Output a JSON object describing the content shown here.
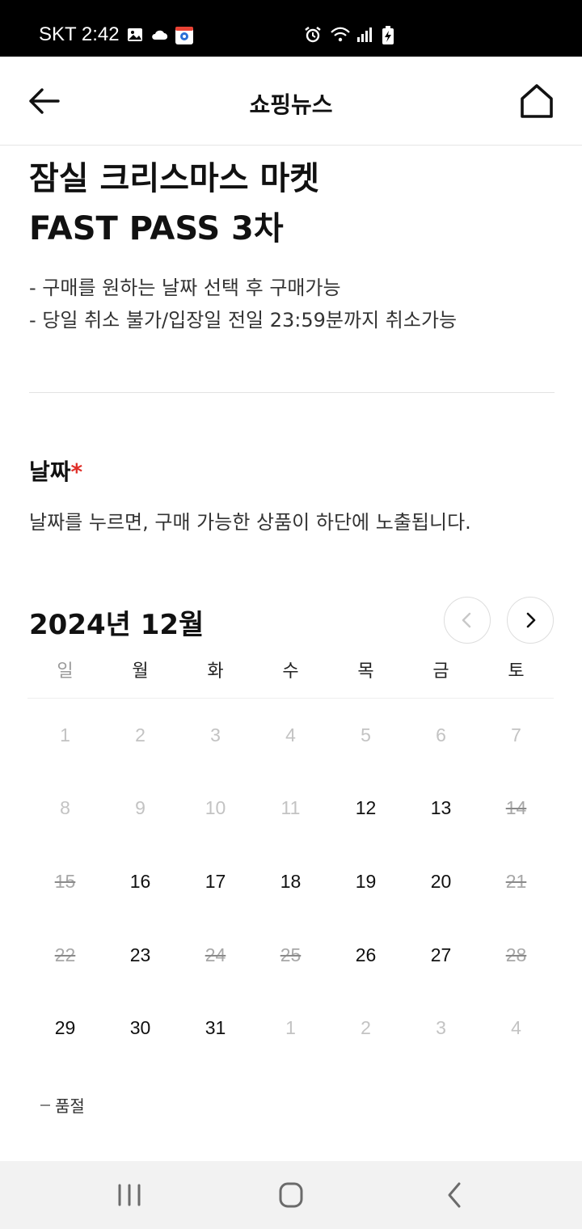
{
  "status_bar": {
    "carrier_time": "SKT 2:42",
    "left_icons": [
      "image-icon",
      "cloud-icon",
      "map-app-icon"
    ],
    "right_icons": [
      "alarm-icon",
      "wifi-icon",
      "signal-icon",
      "battery-charging-icon"
    ]
  },
  "header": {
    "title": "쇼핑뉴스",
    "back_icon": "arrow-left-icon",
    "home_icon": "home-icon"
  },
  "product": {
    "title_line1": "잠실 크리스마스 마켓",
    "title_line2": "FAST PASS 3차",
    "notes": [
      "- 구매를 원하는 날짜 선택 후 구매가능",
      "- 당일 취소 불가/입장일 전일 23:59분까지 취소가능"
    ]
  },
  "date_section": {
    "label": "날짜",
    "required_mark": "*",
    "help": "날짜를 누르면, 구매 가능한 상품이 하단에 노출됩니다."
  },
  "calendar": {
    "month_title": "2024년 12월",
    "weekdays": [
      "일",
      "월",
      "화",
      "수",
      "목",
      "금",
      "토"
    ],
    "days": [
      {
        "label": "1",
        "state": "dim"
      },
      {
        "label": "2",
        "state": "dim"
      },
      {
        "label": "3",
        "state": "dim"
      },
      {
        "label": "4",
        "state": "dim"
      },
      {
        "label": "5",
        "state": "dim"
      },
      {
        "label": "6",
        "state": "dim"
      },
      {
        "label": "7",
        "state": "dim"
      },
      {
        "label": "8",
        "state": "dim"
      },
      {
        "label": "9",
        "state": "dim"
      },
      {
        "label": "10",
        "state": "dim"
      },
      {
        "label": "11",
        "state": "dim"
      },
      {
        "label": "12",
        "state": "avail"
      },
      {
        "label": "13",
        "state": "avail"
      },
      {
        "label": "14",
        "state": "soldout"
      },
      {
        "label": "15",
        "state": "soldout"
      },
      {
        "label": "16",
        "state": "avail"
      },
      {
        "label": "17",
        "state": "avail"
      },
      {
        "label": "18",
        "state": "avail"
      },
      {
        "label": "19",
        "state": "avail"
      },
      {
        "label": "20",
        "state": "avail"
      },
      {
        "label": "21",
        "state": "soldout"
      },
      {
        "label": "22",
        "state": "soldout"
      },
      {
        "label": "23",
        "state": "avail"
      },
      {
        "label": "24",
        "state": "soldout"
      },
      {
        "label": "25",
        "state": "soldout"
      },
      {
        "label": "26",
        "state": "avail"
      },
      {
        "label": "27",
        "state": "avail"
      },
      {
        "label": "28",
        "state": "soldout"
      },
      {
        "label": "29",
        "state": "avail"
      },
      {
        "label": "30",
        "state": "avail"
      },
      {
        "label": "31",
        "state": "avail"
      },
      {
        "label": "1",
        "state": "dim"
      },
      {
        "label": "2",
        "state": "dim"
      },
      {
        "label": "3",
        "state": "dim"
      },
      {
        "label": "4",
        "state": "dim"
      }
    ],
    "legend_label": "품절"
  },
  "nav_bar": {
    "icons": [
      "recent-apps-icon",
      "home-circle-icon",
      "back-chevron-icon"
    ]
  }
}
